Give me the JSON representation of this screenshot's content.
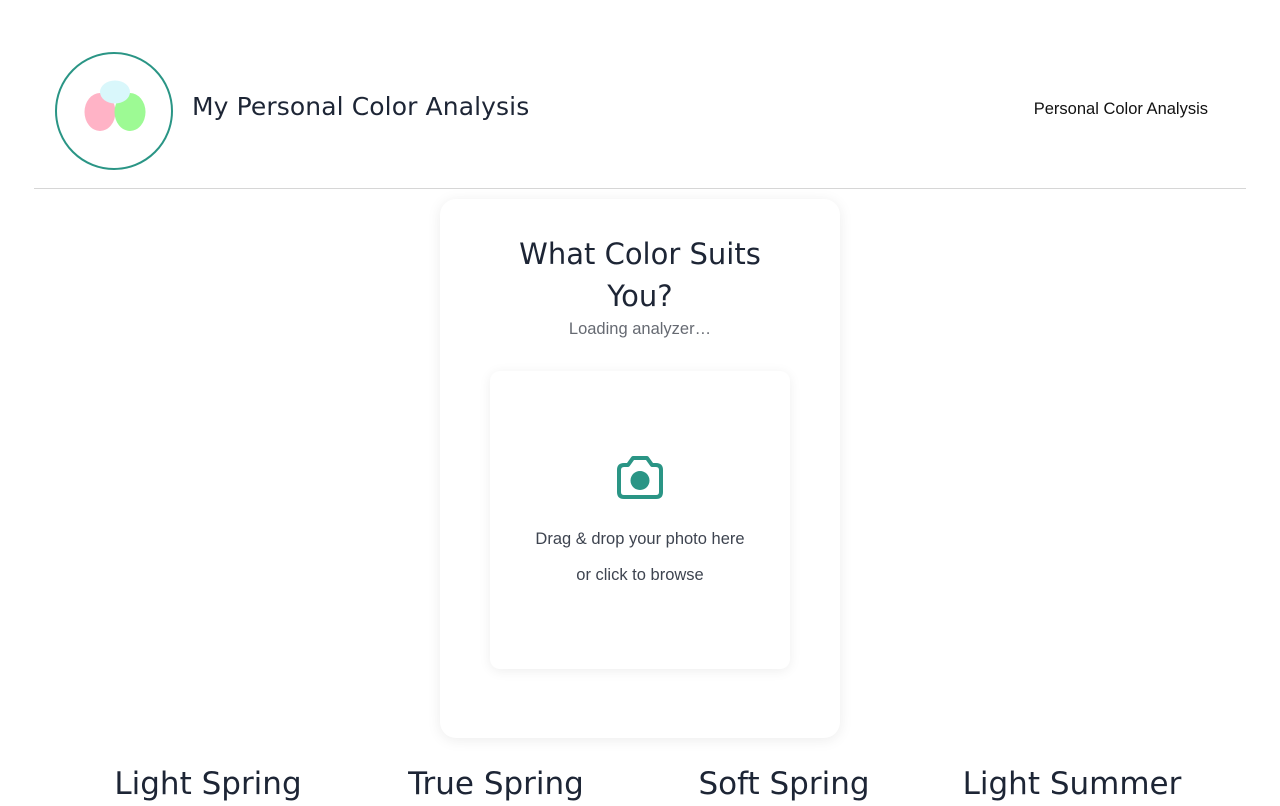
{
  "header": {
    "site_title": "My Personal Color Analysis",
    "nav_link": "Personal Color Analysis",
    "logo": {
      "icon": "color-blobs-logo",
      "accent": "#2a9585",
      "colors": [
        "#ffb3c6",
        "#9dfa94",
        "#d9f7fb"
      ]
    }
  },
  "card": {
    "title": "What Color Suits You?",
    "status": "Loading analyzer…",
    "dropzone": {
      "icon": "camera-icon",
      "line1": "Drag & drop your photo here",
      "line2": "or click to browse"
    }
  },
  "seasons": [
    {
      "label": "Light Spring"
    },
    {
      "label": "True Spring"
    },
    {
      "label": "Soft Spring"
    },
    {
      "label": "Light Summer"
    }
  ],
  "colors": {
    "accent": "#2a9585",
    "title": "#1d2535",
    "muted": "#666a72"
  }
}
